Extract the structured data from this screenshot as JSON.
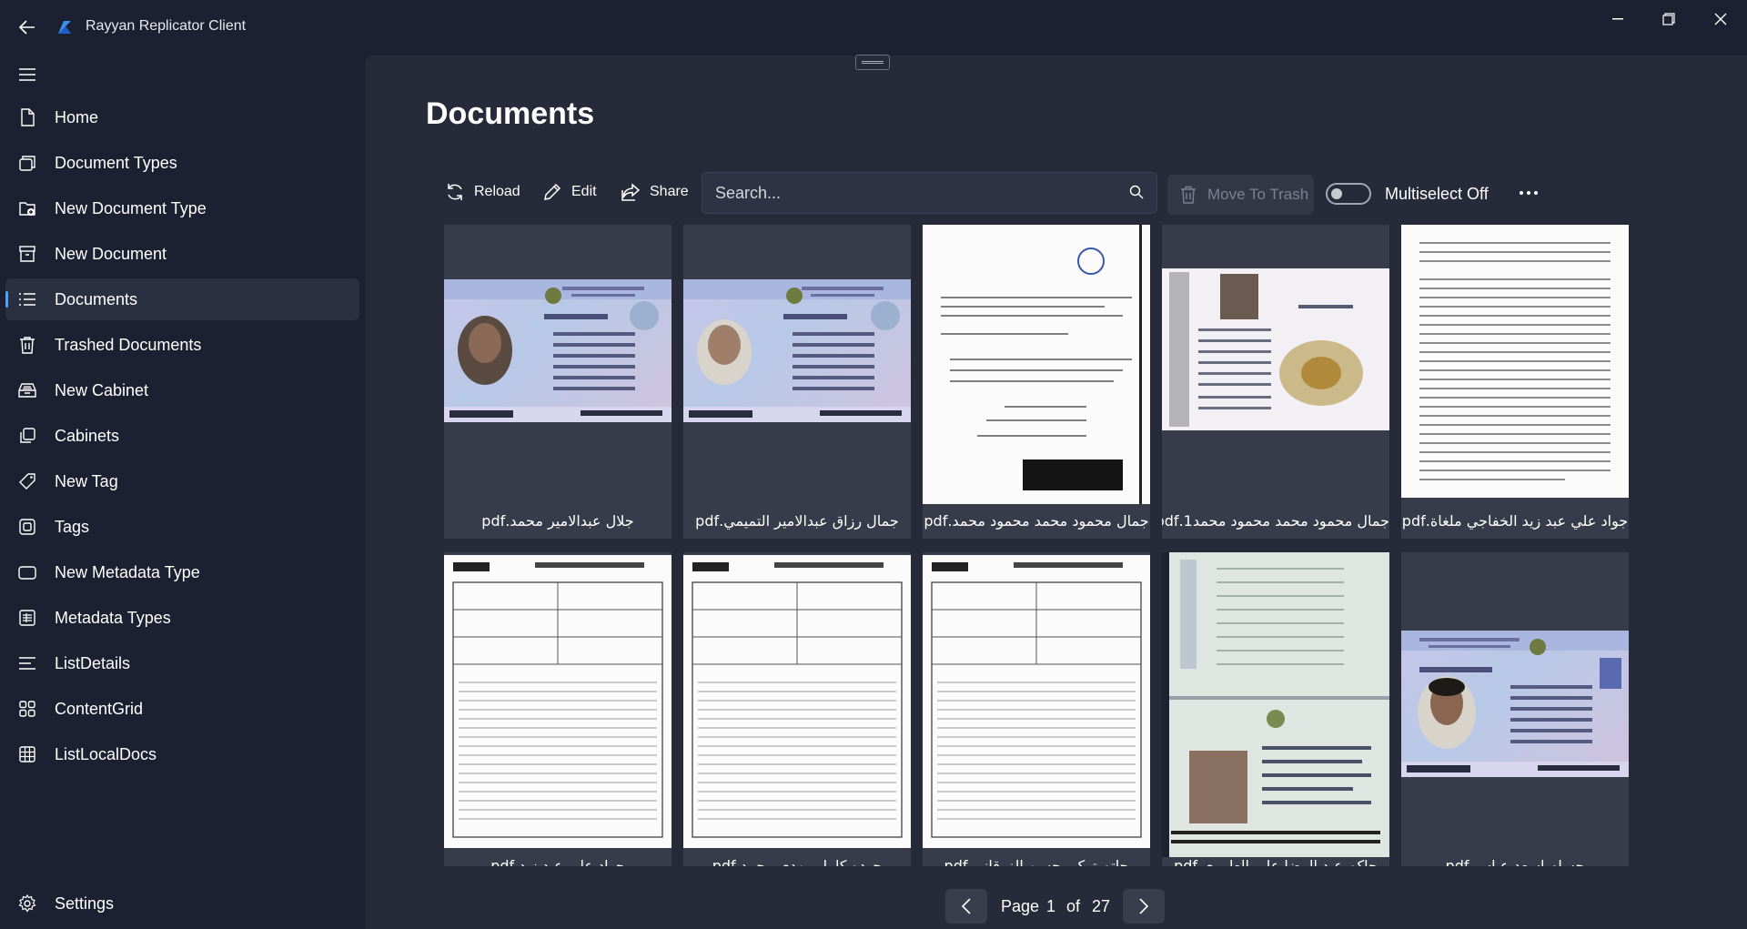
{
  "app": {
    "title": "Rayyan Replicator Client"
  },
  "sidebar": {
    "items": [
      {
        "label": "Home",
        "icon": "document-icon"
      },
      {
        "label": "Document Types",
        "icon": "document-stack-icon"
      },
      {
        "label": "New Document Type",
        "icon": "folder-add-icon"
      },
      {
        "label": "New Document",
        "icon": "archive-icon"
      },
      {
        "label": "Documents",
        "icon": "list-icon",
        "active": true
      },
      {
        "label": "Trashed Documents",
        "icon": "trash-icon"
      },
      {
        "label": "New Cabinet",
        "icon": "cabinet-icon"
      },
      {
        "label": "Cabinets",
        "icon": "copy-icon"
      },
      {
        "label": "New Tag",
        "icon": "tag-icon"
      },
      {
        "label": "Tags",
        "icon": "tags-icon"
      },
      {
        "label": "New Metadata Type",
        "icon": "rectangle-icon"
      },
      {
        "label": "Metadata Types",
        "icon": "grid-document-icon"
      },
      {
        "label": "ListDetails",
        "icon": "lines-icon"
      },
      {
        "label": "ContentGrid",
        "icon": "four-squares-icon"
      },
      {
        "label": "ListLocalDocs",
        "icon": "table-icon"
      }
    ],
    "settings_label": "Settings"
  },
  "page": {
    "title": "Documents"
  },
  "toolbar": {
    "reload_label": "Reload",
    "edit_label": "Edit",
    "share_label": "Share",
    "search_placeholder": "Search...",
    "trash_label": "Move To Trash",
    "multiselect_label": "Multiselect Off"
  },
  "documents": [
    {
      "name": "جلال عبدالامير محمد.pdf",
      "thumb": "id-card"
    },
    {
      "name": "جمال رزاق عبدالامير التميمي.pdf",
      "thumb": "id-card"
    },
    {
      "name": "جمال محمود محمد محمود محمد.pdf",
      "thumb": "document"
    },
    {
      "name": "جمال محمود محمد محمود محمد1.pdf",
      "thumb": "passport-open"
    },
    {
      "name": "جواد علي عبد زيد الخفاجي ملغاة.pdf",
      "thumb": "document"
    },
    {
      "name": "جواد علي عبد زيد.pdf",
      "thumb": "receipt"
    },
    {
      "name": "جوده كامل مهدي محمد.pdf",
      "thumb": "receipt"
    },
    {
      "name": "حاتم تركي حسن الزرقاني.pdf",
      "thumb": "receipt"
    },
    {
      "name": "حاكم عبد الرضا علي العامري.pdf",
      "thumb": "passport"
    },
    {
      "name": "حسام اسعد عباس.pdf",
      "thumb": "id-card"
    }
  ],
  "pagination": {
    "page_label": "Page",
    "current": "1",
    "of_label": "of",
    "total": "27"
  },
  "colors": {
    "accent": "#4aa3ff",
    "background": "#1c2030",
    "pane": "#272a38",
    "card": "#373b4a"
  }
}
